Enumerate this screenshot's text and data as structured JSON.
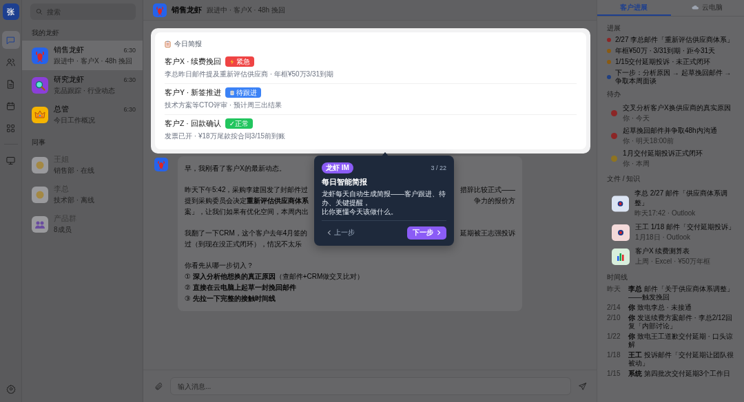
{
  "rail": {
    "avatar": "张",
    "items": [
      {
        "kind": "chat",
        "selected": true
      },
      {
        "kind": "contacts",
        "selected": false
      },
      {
        "kind": "docs",
        "selected": false
      },
      {
        "kind": "calendar",
        "selected": false
      },
      {
        "kind": "apps",
        "selected": false
      },
      {
        "kind": "desktop",
        "selected": false
      }
    ]
  },
  "conversations": {
    "search_placeholder": "搜索",
    "groups": [
      {
        "label": "我的龙虾",
        "items": [
          {
            "kind": "lobster",
            "name": "销售龙虾",
            "preview": "跟进中 · 客户X · 48h 挽回",
            "time": "6:30",
            "selected": true,
            "disabled": false
          },
          {
            "kind": "research",
            "name": "研究龙虾",
            "preview": "竞品跟踪 · 行业动态",
            "time": "6:30",
            "selected": false,
            "disabled": false
          },
          {
            "kind": "crown",
            "name": "总管",
            "preview": "今日工作概况",
            "time": "6:30",
            "selected": false,
            "disabled": false
          }
        ]
      },
      {
        "label": "同事",
        "items": [
          {
            "kind": "person",
            "name": "王姐",
            "preview": "销售部 · 在线",
            "selected": false,
            "disabled": true
          },
          {
            "kind": "person",
            "name": "李总",
            "preview": "技术部 · 离线",
            "selected": false,
            "disabled": true
          },
          {
            "kind": "group",
            "name": "产品群",
            "preview": "8成员",
            "selected": false,
            "disabled": true
          }
        ]
      }
    ]
  },
  "chat": {
    "title": "销售龙虾",
    "subtitle": "跟进中 · 客户X · 48h 挽回",
    "brief": {
      "title": "今日简报",
      "items": [
        {
          "title": "客户X · 续费挽回",
          "tag": {
            "kind": "urgent",
            "text": "紧急",
            "color": "#ef4444"
          },
          "desc": "李总昨日邮件提及重新评估供应商 · 年框¥50万3/31到期"
        },
        {
          "title": "客户Y · 新签推进",
          "tag": {
            "kind": "pending",
            "text": "待跟进",
            "color": "#3b82f6"
          },
          "desc": "技术方案等CTO评审 · 预计周三出结果"
        },
        {
          "title": "客户Z · 回款确认",
          "tag": {
            "kind": "ok",
            "text": "✓正常",
            "color": "#22c55e"
          },
          "desc": "发票已开 · ¥18万尾款按合同3/15前到账"
        }
      ]
    },
    "message": {
      "paragraphs": [
        [
          {
            "left": "早，我刚看了客户X的最新动态。"
          }
        ],
        [
          {
            "left": "昨天下午5:42，采购李建国发了封邮件过",
            "right": "措辞比较正式——"
          },
          {
            "left": "提到采购委员会决定**重新评估供应商体系**",
            "right": "争力的报价方"
          },
          {
            "left": "案」，让我们如果有优化空间，本周内出"
          }
        ],
        [
          {
            "left": "我翻了一下CRM，这个客户去年4月签的",
            "right": "延期被王志强投诉"
          },
          {
            "left": "过（到现在没正式闭环），情况不太乐"
          }
        ],
        [
          {
            "left": "你看先从哪一步切入？"
          },
          {
            "left": "① **深入分析他想换的真正原因**（查邮件+CRM做交叉比对）"
          },
          {
            "left": "② **直接在云电脑上起草一封挽回邮件**"
          },
          {
            "left": "③ **先拉一下完整的接触时间线**"
          }
        ]
      ]
    },
    "input_placeholder": "输入消息..."
  },
  "tour": {
    "badge": "龙虾 IM",
    "step": "3 / 22",
    "title": "每日智能简报",
    "lines": [
      "龙虾每天自动生成简报——客户跟进、待办、关键提醒，",
      "比你更懂今天该做什么。"
    ],
    "prev": "上一步",
    "next": "下一步"
  },
  "panel": {
    "tabs": [
      {
        "label": "客户进展",
        "selected": true
      },
      {
        "label": "云电脑",
        "selected": false
      }
    ],
    "progress": {
      "label": "进展",
      "items": [
        {
          "text": "2/27 李总邮件「重新评估供应商体系」",
          "color": "#8c2626"
        },
        {
          "text": "年框¥50万 · 3/31到期 · 距今31天",
          "color": "#8a5a10"
        },
        {
          "text": "1/15交付延期投诉 · 未正式闭环",
          "color": "#8a5a10"
        },
        {
          "text": "下一步：分析原因 → 起草挽回邮件 → 争取本周面谈",
          "color": "#203f80"
        }
      ]
    },
    "todos": {
      "label": "待办",
      "items": [
        {
          "title": "交叉分析客户X换供应商的真实原因",
          "sub": "你 · 今天",
          "color": "#8c2626"
        },
        {
          "title": "起草挽回邮件并争取48h内沟通",
          "sub": "你 · 明天18:00前",
          "color": "#8c2626"
        },
        {
          "title": "1月交付延期投诉正式闭环",
          "sub": "你 · 本周",
          "color": "#8f7420"
        }
      ]
    },
    "files": {
      "label": "文件 / 知识",
      "items": [
        {
          "kind": "mail",
          "title": "李总 2/27 邮件「供应商体系调整」",
          "sub": "昨天17:42 · Outlook"
        },
        {
          "kind": "mail-alert",
          "title": "王工 1/18 邮件「交付延期投诉」",
          "sub": "1月18日 · Outlook"
        },
        {
          "kind": "sheet",
          "title": "客户X 续费测算表",
          "sub": "上周 · Excel · ¥50万年框"
        }
      ]
    },
    "timeline": {
      "label": "时间线",
      "items": [
        {
          "date": "昨天",
          "text": "**李总** 邮件「关于供应商体系调整」——触发挽回"
        },
        {
          "date": "2/14",
          "text": "**你** 致电李总 · 未接通"
        },
        {
          "date": "2/10",
          "text": "**你** 发送续费方案邮件 · 李总2/12回复「内部讨论」"
        },
        {
          "date": "1/22",
          "text": "**你** 致电王工道歉交付延期 · 口头谅解"
        },
        {
          "date": "1/18",
          "text": "**王工** 投诉邮件「交付延期让团队很被动」"
        },
        {
          "date": "1/15",
          "text": "**系统** 第四批次交付延期3个工作日"
        }
      ]
    }
  }
}
